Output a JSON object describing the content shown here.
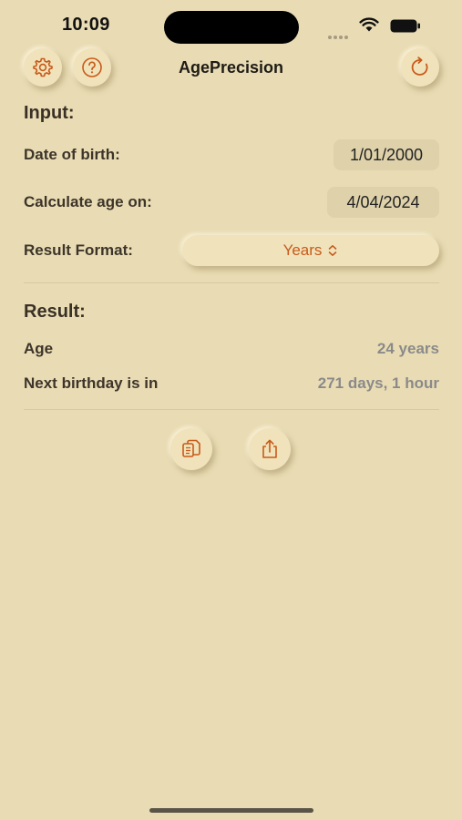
{
  "status_bar": {
    "time": "10:09"
  },
  "header": {
    "title": "AgePrecision",
    "settings_icon": "gear-icon",
    "help_icon": "question-circle-icon",
    "reset_icon": "refresh-icon"
  },
  "input": {
    "section_title": "Input:",
    "dob_label": "Date of birth:",
    "dob_value": "1/01/2000",
    "calc_label": "Calculate age on:",
    "calc_value": "4/04/2024",
    "format_label": "Result Format:",
    "format_value": "Years"
  },
  "result": {
    "section_title": "Result:",
    "age_label": "Age",
    "age_value": "24 years",
    "next_label": "Next birthday is in",
    "next_value": "271 days, 1 hour"
  },
  "actions": {
    "copy_icon": "copy-icon",
    "share_icon": "share-icon"
  },
  "colors": {
    "background": "#e9dcb4",
    "accent": "#c85a1a",
    "muted_value": "#8a8a8a"
  }
}
